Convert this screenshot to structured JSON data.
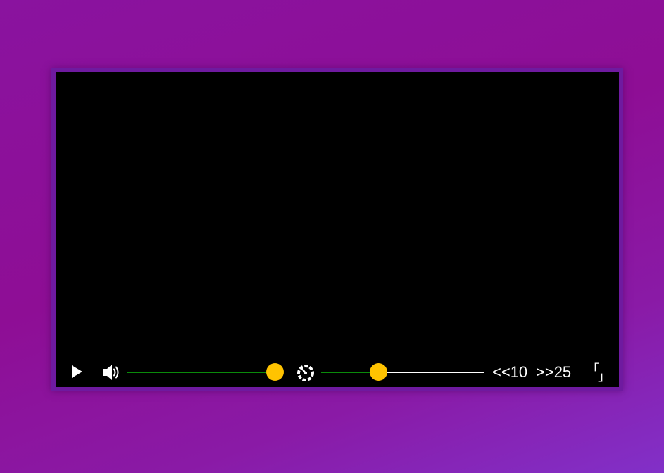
{
  "player": {
    "controls": {
      "play_icon": "play-icon",
      "volume_icon": "speaker-icon",
      "volume_level": 0.95,
      "speed_icon": "speedometer-icon",
      "progress": 0.35,
      "skip_back_label": "<<10",
      "skip_forward_label": ">>25",
      "fullscreen_icon": "fullscreen-icon",
      "fullscreen_corner_top": "「",
      "fullscreen_corner_bottom": "」"
    }
  },
  "colors": {
    "background_gradient": [
      "#8a139f",
      "#8230c8"
    ],
    "frame": "#6f1aa0",
    "screen": "#000000",
    "slider_fill": "#0a8a0a",
    "slider_track": "#ffffff",
    "slider_thumb": "#ffc300"
  }
}
